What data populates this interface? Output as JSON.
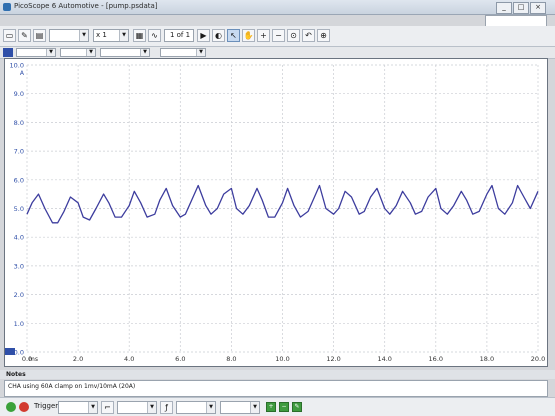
{
  "window": {
    "title": "PicoScope 6 Automotive - [pump.psdata]",
    "minimize": "_",
    "maximize": "□",
    "close": "×"
  },
  "toolbar": {
    "timebase": "",
    "multiplier": "x 1",
    "buffer": "1 of 1",
    "buffer_navigator": "◀▶"
  },
  "trigger": {
    "label": "Trigger"
  },
  "notes": {
    "label": "Notes",
    "text": "CHA using 60A clamp on 1mv/10mA (20A)"
  },
  "accent_colors": {
    "trace": "#3d3d9e",
    "grid": "#c9ccd2",
    "channel": "#2f4fa8"
  },
  "chart_data": {
    "type": "line",
    "xlabel": "ms",
    "ylabel": "A",
    "xlim": [
      0,
      20
    ],
    "ylim": [
      0,
      10
    ],
    "x_ticks": [
      "0.0",
      "2.0",
      "4.0",
      "6.0",
      "8.0",
      "10.0",
      "12.0",
      "14.0",
      "16.0",
      "18.0",
      "20.0"
    ],
    "y_ticks": [
      "0.0",
      "1.0",
      "2.0",
      "3.0",
      "4.0",
      "5.0",
      "6.0",
      "7.0",
      "8.0",
      "9.0",
      "10.0"
    ],
    "grid": true,
    "series": [
      {
        "x": [
          0.0,
          0.2,
          0.45,
          0.7,
          1.0,
          1.2,
          1.45,
          1.7,
          2.0,
          2.2,
          2.45,
          2.7,
          3.0,
          3.2,
          3.45,
          3.7,
          4.0,
          4.2,
          4.45,
          4.7,
          5.0,
          5.2,
          5.45,
          5.7,
          6.0,
          6.2,
          6.45,
          6.7,
          7.0,
          7.2,
          7.45,
          7.7,
          8.0,
          8.2,
          8.45,
          8.7,
          9.0,
          9.2,
          9.45,
          9.7,
          10.0,
          10.2,
          10.45,
          10.7,
          11.0,
          11.2,
          11.45,
          11.7,
          12.0,
          12.2,
          12.45,
          12.7,
          13.0,
          13.2,
          13.45,
          13.7,
          14.0,
          14.2,
          14.45,
          14.7,
          15.0,
          15.2,
          15.45,
          15.7,
          16.0,
          16.2,
          16.45,
          16.7,
          17.0,
          17.2,
          17.45,
          17.7,
          18.0,
          18.2,
          18.45,
          18.7,
          19.0,
          19.2,
          19.45,
          19.7,
          20.0
        ],
        "y": [
          4.8,
          5.2,
          5.5,
          5.0,
          4.5,
          4.5,
          4.9,
          5.4,
          5.2,
          4.7,
          4.6,
          5.0,
          5.5,
          5.2,
          4.7,
          4.7,
          5.1,
          5.6,
          5.2,
          4.7,
          4.8,
          5.3,
          5.7,
          5.1,
          4.7,
          4.8,
          5.3,
          5.8,
          5.1,
          4.8,
          5.0,
          5.5,
          5.7,
          5.0,
          4.8,
          5.1,
          5.7,
          5.3,
          4.7,
          4.7,
          5.2,
          5.7,
          5.1,
          4.7,
          4.9,
          5.3,
          5.8,
          5.0,
          4.8,
          5.0,
          5.6,
          5.4,
          4.8,
          4.9,
          5.4,
          5.7,
          5.0,
          4.8,
          5.1,
          5.6,
          5.2,
          4.8,
          4.9,
          5.4,
          5.7,
          5.0,
          4.8,
          5.1,
          5.6,
          5.3,
          4.8,
          4.9,
          5.5,
          5.8,
          5.0,
          4.8,
          5.2,
          5.8,
          5.4,
          5.0,
          5.6
        ]
      }
    ]
  }
}
